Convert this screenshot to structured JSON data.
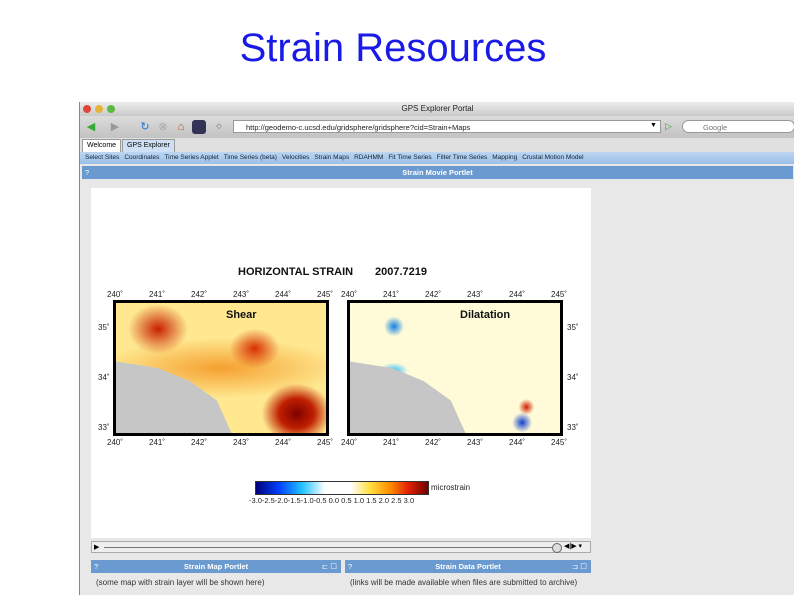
{
  "slide_title": "Strain Resources",
  "window": {
    "title": "GPS Explorer Portal",
    "url": "http://geodemo-c.ucsd.edu/gridsphere/gridsphere?cid=Strain+Maps",
    "search_placeholder": "Google"
  },
  "tabs": [
    "Welcome",
    "GPS Explorer"
  ],
  "nav": [
    "Select Sites",
    "Coordinates",
    "Time Series Applet",
    "Time Series (beta)",
    "Velocities",
    "Strain Maps",
    "RDAHMM",
    "Fit Time Series",
    "Filter Time Series",
    "Mapping",
    "Crustal Motion Model"
  ],
  "movie_portlet": {
    "help": "?",
    "title": "Strain Movie Portlet",
    "figure_title": "HORIZONTAL STRAIN",
    "epoch": "2007.7219",
    "panels": [
      "Shear",
      "Dilatation"
    ],
    "lon_ticks": [
      "240˚",
      "241˚",
      "242˚",
      "243˚",
      "244˚",
      "245˚"
    ],
    "lat_ticks": [
      "35˚",
      "34˚",
      "33˚"
    ],
    "colorbar_ticks": "-3.0-2.5-2.0-1.5-1.0-0.5 0.0 0.5 1.0 1.5 2.0 2.5 3.0",
    "colorbar_unit": "microstrain"
  },
  "map_portlet": {
    "help": "?",
    "title": "Strain Map Portlet",
    "body": "(some map with strain layer will be shown here)"
  },
  "data_portlet": {
    "help": "?",
    "title": "Strain Data Portlet",
    "body": "(links will be made available when files are submitted to archive)"
  }
}
